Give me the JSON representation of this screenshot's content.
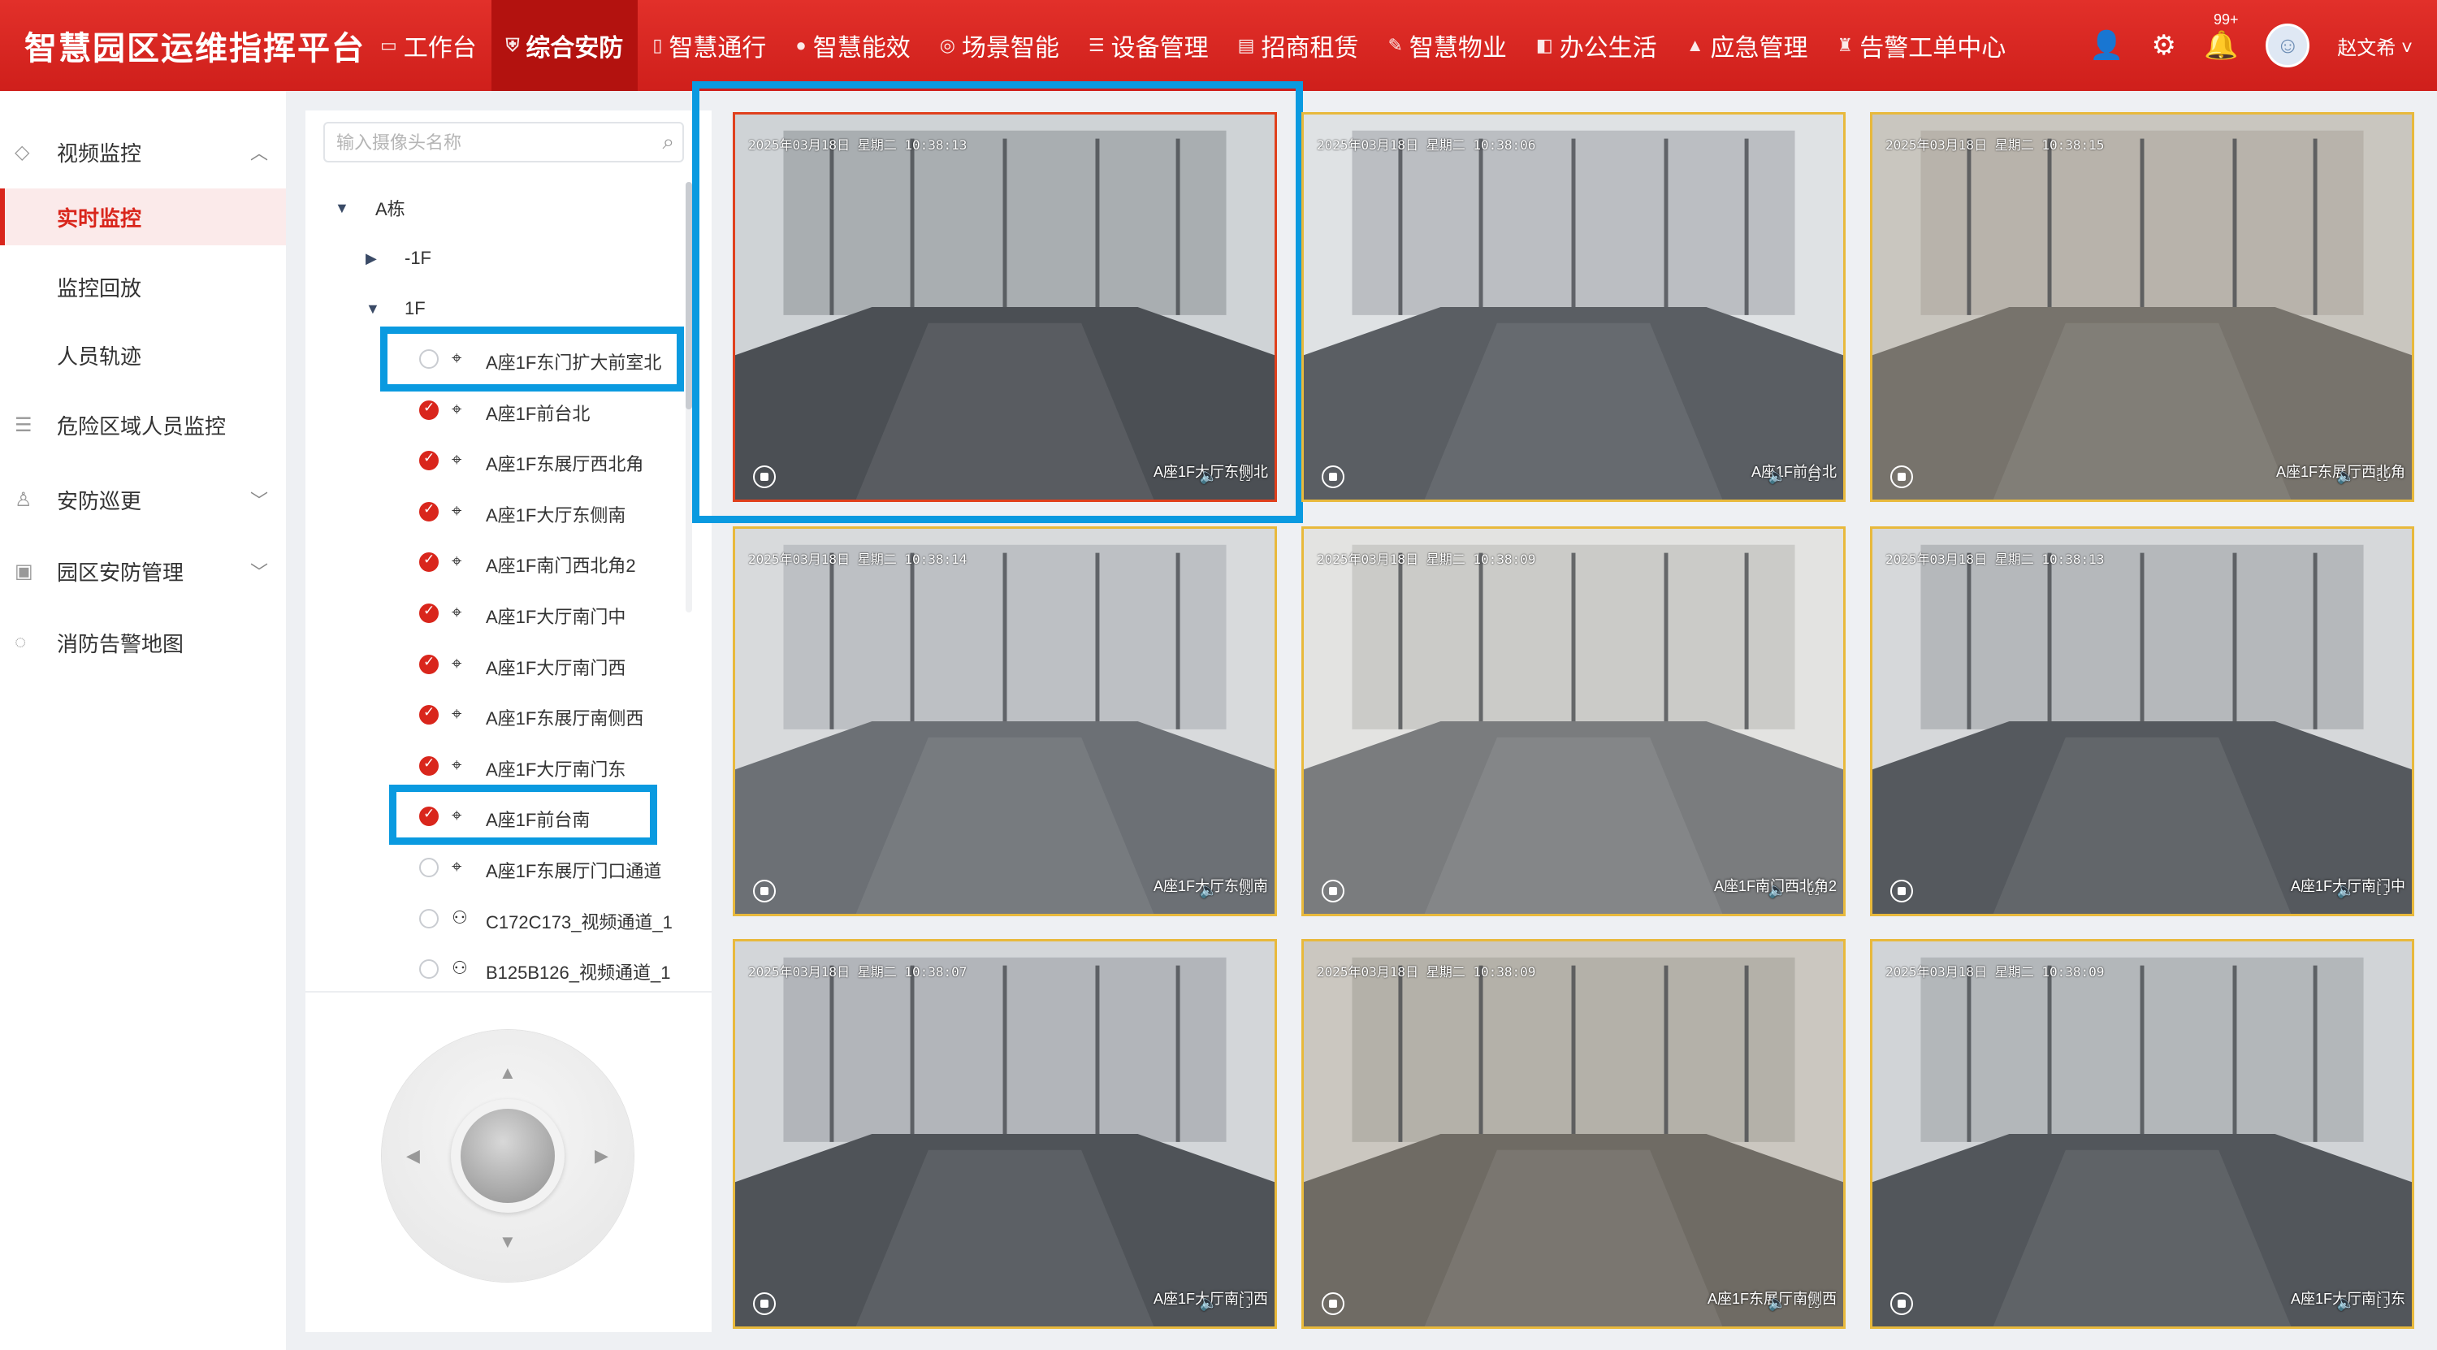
{
  "app": {
    "title": "智慧园区运维指挥平台"
  },
  "nav": [
    {
      "label": "工作台",
      "icon": "monitor-icon"
    },
    {
      "label": "综合安防",
      "icon": "shield-icon",
      "active": true
    },
    {
      "label": "智慧通行",
      "icon": "door-icon"
    },
    {
      "label": "智慧能效",
      "icon": "energy-icon"
    },
    {
      "label": "场景智能",
      "icon": "scene-icon"
    },
    {
      "label": "设备管理",
      "icon": "device-icon"
    },
    {
      "label": "招商租赁",
      "icon": "lease-icon"
    },
    {
      "label": "智慧物业",
      "icon": "property-icon"
    },
    {
      "label": "办公生活",
      "icon": "office-icon"
    },
    {
      "label": "应急管理",
      "icon": "warning-icon"
    },
    {
      "label": "告警工单中心",
      "icon": "alarm-icon"
    }
  ],
  "header": {
    "notification_count": "99+",
    "user_name": "赵文希"
  },
  "sidebar": {
    "items": [
      {
        "label": "视频监控",
        "icon": "video-icon",
        "expanded": true
      },
      {
        "label": "实时监控",
        "selected": true
      },
      {
        "label": "监控回放"
      },
      {
        "label": "人员轨迹"
      },
      {
        "label": "危险区域人员监控",
        "icon": "sliders-icon"
      },
      {
        "label": "安防巡更",
        "icon": "patrol-icon"
      },
      {
        "label": "园区安防管理",
        "icon": "calendar-icon"
      },
      {
        "label": "消防告警地图",
        "icon": "fire-map-icon"
      }
    ]
  },
  "tree": {
    "search_placeholder": "输入摄像头名称",
    "building": "A栋",
    "floors": [
      "-1F",
      "1F"
    ],
    "cameras": [
      {
        "label": "A座1F东门扩大前室北",
        "checked": false,
        "icon": "dome-camera-icon"
      },
      {
        "label": "A座1F前台北",
        "checked": true,
        "icon": "dome-camera-icon"
      },
      {
        "label": "A座1F东展厅西北角",
        "checked": true,
        "icon": "dome-camera-icon"
      },
      {
        "label": "A座1F大厅东侧南",
        "checked": true,
        "icon": "dome-camera-icon"
      },
      {
        "label": "A座1F南门西北角2",
        "checked": true,
        "icon": "dome-camera-icon"
      },
      {
        "label": "A座1F大厅南门中",
        "checked": true,
        "icon": "dome-camera-icon"
      },
      {
        "label": "A座1F大厅南门西",
        "checked": true,
        "icon": "dome-camera-icon"
      },
      {
        "label": "A座1F东展厅南侧西",
        "checked": true,
        "icon": "dome-camera-icon"
      },
      {
        "label": "A座1F大厅南门东",
        "checked": true,
        "icon": "dome-camera-icon"
      },
      {
        "label": "A座1F前台南",
        "checked": true,
        "icon": "dome-camera-icon"
      },
      {
        "label": "A座1F东展厅门口通道",
        "checked": false,
        "icon": "dome-camera-icon"
      },
      {
        "label": "C172C173_视频通道_1",
        "checked": false,
        "icon": "ball-camera-icon"
      },
      {
        "label": "B125B126_视频通道_1",
        "checked": false,
        "icon": "ball-camera-icon"
      }
    ]
  },
  "videos": [
    {
      "timestamp": "2025年03月18日 星期二 10:38:13",
      "name": "A座1F大厅东侧北",
      "selected": true
    },
    {
      "timestamp": "2025年03月18日 星期二 10:38:06",
      "name": "A座1F前台北"
    },
    {
      "timestamp": "2025年03月18日 星期二 10:38:15",
      "name": "A座1F东展厅西北角"
    },
    {
      "timestamp": "2025年03月18日 星期二 10:38:14",
      "name": "A座1F大厅东侧南"
    },
    {
      "timestamp": "2025年03月18日 星期二 10:38:09",
      "name": "A座1F南门西北角2"
    },
    {
      "timestamp": "2025年03月18日 星期二 10:38:13",
      "name": "A座1F大厅南门中"
    },
    {
      "timestamp": "2025年03月18日 星期二 10:38:07",
      "name": "A座1F大厅南门西"
    },
    {
      "timestamp": "2025年03月18日 星期二 10:38:09",
      "name": "A座1F东展厅南侧西"
    },
    {
      "timestamp": "2025年03月18日 星期二 10:38:09",
      "name": "A座1F大厅南门东"
    }
  ],
  "colors": {
    "brand_red": "#d9261c",
    "highlight_blue": "#0a9ae0",
    "tile_border": "#e8b93c"
  }
}
